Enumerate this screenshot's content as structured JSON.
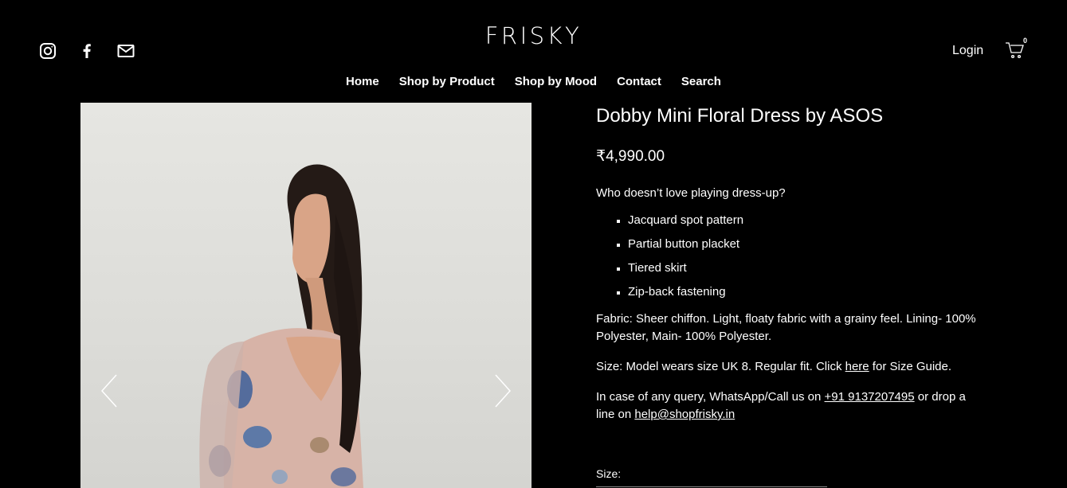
{
  "header": {
    "logo": "FRISKY",
    "login_label": "Login",
    "cart_count": "0",
    "social_icons": [
      "instagram-icon",
      "facebook-icon",
      "mail-icon"
    ]
  },
  "nav": {
    "items": [
      {
        "label": "Home"
      },
      {
        "label": "Shop by Product"
      },
      {
        "label": "Shop by Mood"
      },
      {
        "label": "Contact"
      },
      {
        "label": "Search"
      }
    ]
  },
  "product": {
    "title": "Dobby Mini Floral Dress by ASOS",
    "price": "₹4,990.00",
    "intro": "Who doesn’t love playing dress-up?",
    "features": [
      "Jacquard spot pattern",
      "Partial button placket",
      "Tiered skirt",
      "Zip-back fastening"
    ],
    "fabric": "Fabric: Sheer chiffon. Light, floaty fabric with a grainy feel. Lining- 100% Polyester, Main- 100% Polyester.",
    "size_text_before": "Size: Model wears size UK 8. Regular fit. Click ",
    "size_link": "here",
    "size_text_after": " for Size Guide.",
    "query_text_before": "In case of any query, WhatsApp/Call us on ",
    "phone": "+91 9137207495",
    "query_text_middle": " or drop a line on ",
    "email": "help@shopfrisky.in",
    "size_label": "Size:"
  },
  "colors": {
    "background": "#000000",
    "text": "#ffffff"
  }
}
